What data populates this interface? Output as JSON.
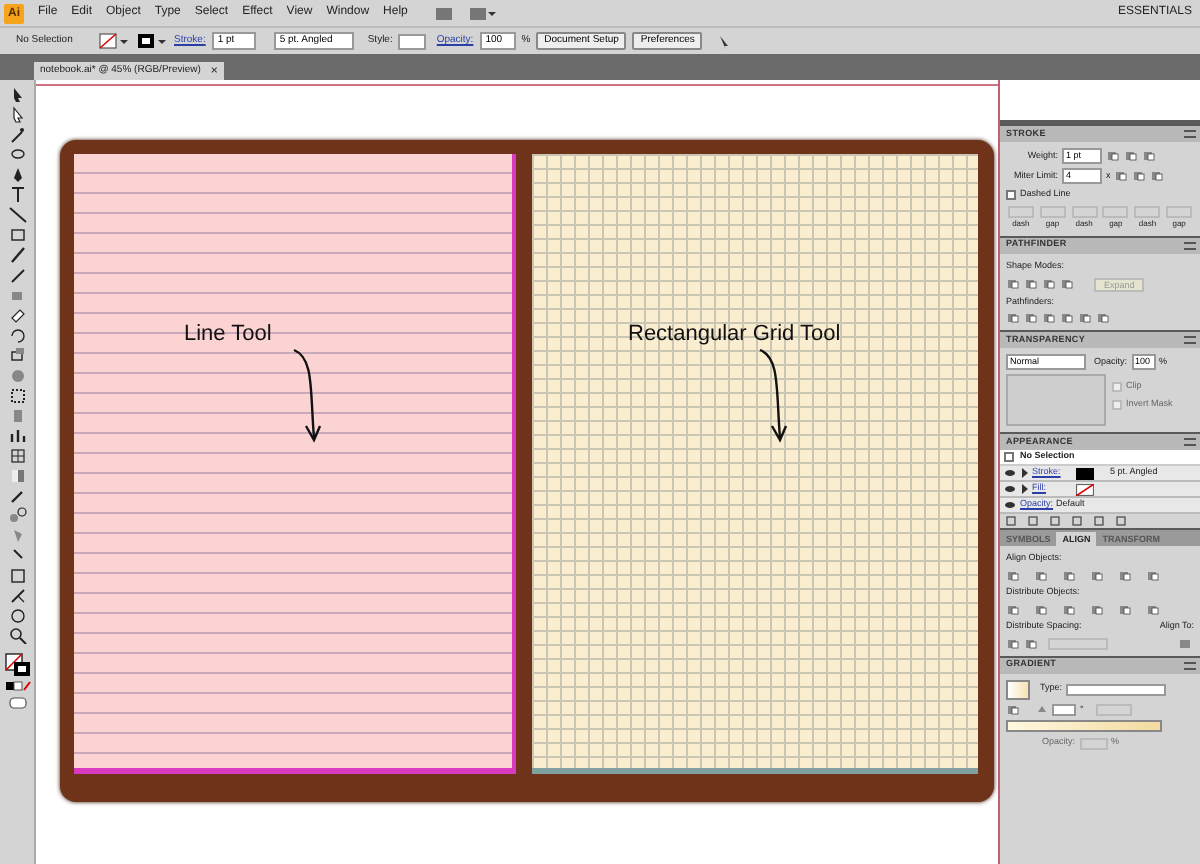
{
  "menu_bar": {
    "logo": "Ai",
    "items": [
      "File",
      "Edit",
      "Object",
      "Type",
      "Select",
      "Effect",
      "View",
      "Window",
      "Help"
    ],
    "workspace": "ESSENTIALS"
  },
  "control_bar": {
    "selection": "No Selection",
    "stroke_label": "Stroke:",
    "stroke_weight": "1 pt",
    "brush": "5 pt. Angled",
    "style_label": "Style:",
    "opacity_label": "Opacity:",
    "opacity": "100",
    "percent": "%",
    "buttons": [
      "Document Setup",
      "Preferences"
    ]
  },
  "document_tab": {
    "title": "notebook.ai* @ 45% (RGB/Preview)",
    "close": "×"
  },
  "canvas": {
    "labels": [
      "Line Tool",
      "Rectangular Grid Tool"
    ]
  },
  "stroke_panel": {
    "title": "STROKE",
    "weight_label": "Weight:",
    "weight": "1 pt",
    "miter_label": "Miter Limit:",
    "miter": "4",
    "miter_unit": "x",
    "dashed_line": {
      "label": "Dashed Line",
      "checked": false
    },
    "dash_fields": [
      "dash",
      "gap",
      "dash",
      "gap",
      "dash",
      "gap"
    ]
  },
  "pathfinder_panel": {
    "title": "PATHFINDER",
    "shape_modes_label": "Shape Modes:",
    "expand": "Expand",
    "pathfinders_label": "Pathfinders:"
  },
  "transparency_panel": {
    "title": "TRANSPARENCY",
    "blend_mode": "Normal",
    "opacity_label": "Opacity:",
    "opacity": "100",
    "percent": "%",
    "options": [
      {
        "label": "Clip",
        "checked": false
      },
      {
        "label": "Invert Mask",
        "checked": false
      }
    ]
  },
  "appearance_panel": {
    "title": "APPEARANCE",
    "header": "No Selection",
    "rows": [
      {
        "kind": "stroke",
        "label": "Stroke:",
        "value": "5 pt. Angled"
      },
      {
        "kind": "fill",
        "label": "Fill:",
        "value": ""
      },
      {
        "kind": "opacity",
        "label": "Opacity:",
        "value": "Default"
      }
    ]
  },
  "panel_tabs": [
    {
      "label": "SYMBOLS",
      "selected": false
    },
    {
      "label": "ALIGN",
      "selected": true
    },
    {
      "label": "TRANSFORM",
      "selected": false
    }
  ],
  "align_panel": {
    "align_objects": "Align Objects:",
    "distribute_objects": "Distribute Objects:",
    "distribute_spacing": "Distribute Spacing:",
    "align_to": "Align To:"
  },
  "gradient_panel": {
    "title": "GRADIENT",
    "type_label": "Type:",
    "angle_unit": "°",
    "opacity_label": "Opacity:",
    "percent": "%"
  }
}
